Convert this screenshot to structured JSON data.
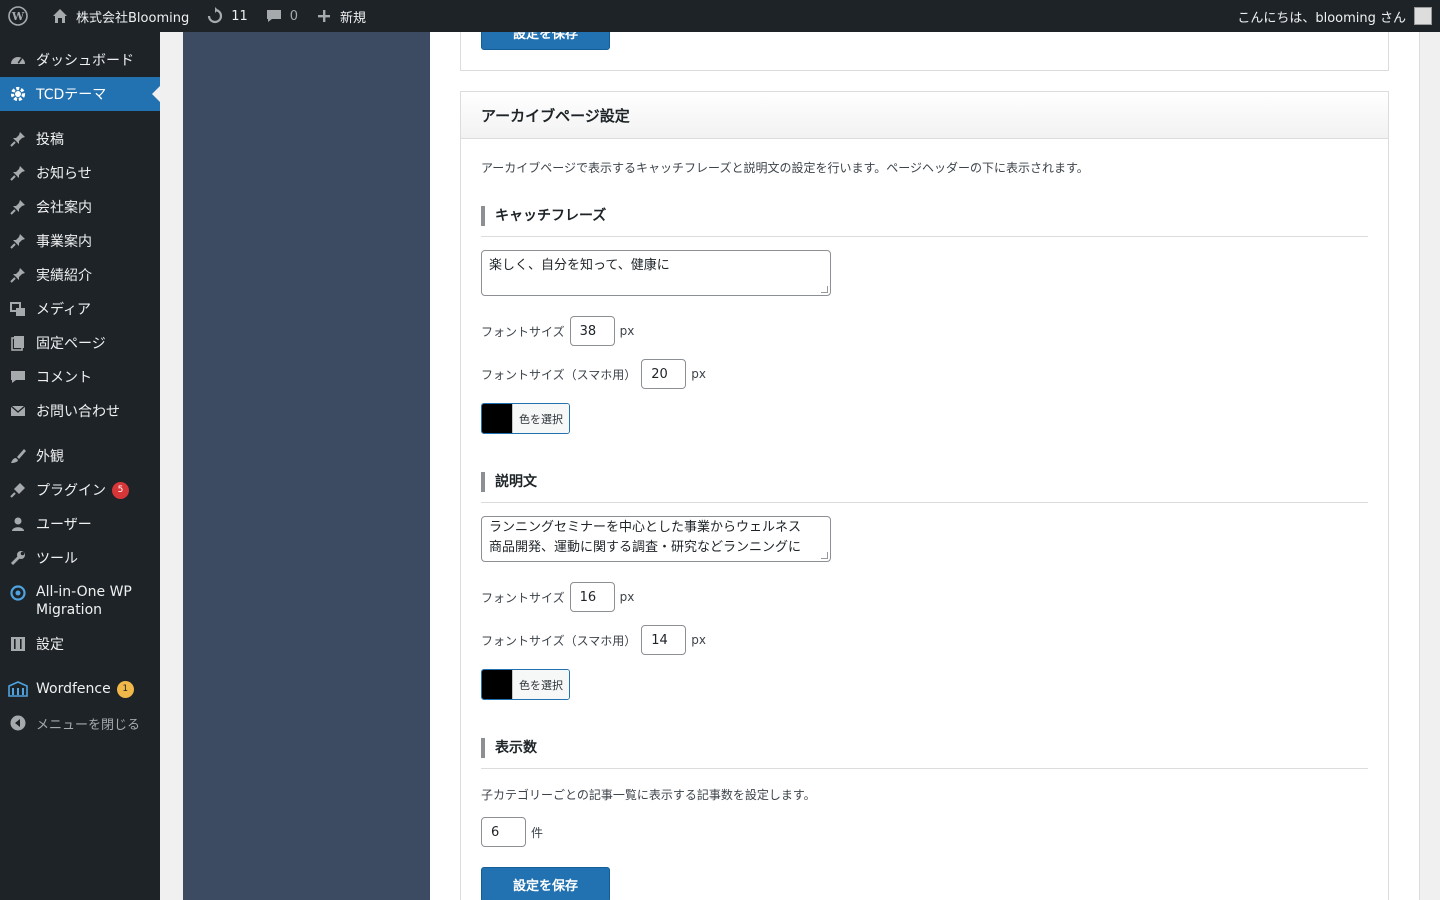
{
  "adminbar": {
    "site_name": "株式会社Blooming",
    "updates_count": "11",
    "comments_count": "0",
    "new_label": "新規",
    "greeting": "こんにちは、blooming さん"
  },
  "sidebar": {
    "items": [
      {
        "label": "ダッシュボード"
      },
      {
        "label": "TCDテーマ"
      },
      {
        "label": "投稿"
      },
      {
        "label": "お知らせ"
      },
      {
        "label": "会社案内"
      },
      {
        "label": "事業案内"
      },
      {
        "label": "実績紹介"
      },
      {
        "label": "メディア"
      },
      {
        "label": "固定ページ"
      },
      {
        "label": "コメント"
      },
      {
        "label": "お問い合わせ"
      },
      {
        "label": "外観"
      },
      {
        "label": "プラグイン",
        "badge": "5"
      },
      {
        "label": "ユーザー"
      },
      {
        "label": "ツール"
      },
      {
        "label": "All-in-One WP Migration"
      },
      {
        "label": "設定"
      },
      {
        "label": "Wordfence",
        "badge": "1"
      },
      {
        "label": "メニューを閉じる"
      }
    ]
  },
  "top_box": {
    "save_label": "設定を保存"
  },
  "archive": {
    "title": "アーカイブページ設定",
    "description": "アーカイブページで表示するキャッチフレーズと説明文の設定を行います。ページヘッダーの下に表示されます。",
    "catchphrase": {
      "heading": "キャッチフレーズ",
      "text": "楽しく、自分を知って、健康に",
      "font_size_label": "フォントサイズ",
      "font_size": "38",
      "font_size_sp_label": "フォントサイズ（スマホ用）",
      "font_size_sp": "20",
      "unit": "px",
      "color_label": "色を選択"
    },
    "explanation": {
      "heading": "説明文",
      "text_line1": "ランニングセミナーを中心とした事業からウェルネス",
      "text_line2": "商品開発、運動に関する調査・研究などランニングに",
      "font_size_label": "フォントサイズ",
      "font_size": "16",
      "font_size_sp_label": "フォントサイズ（スマホ用）",
      "font_size_sp": "14",
      "unit": "px",
      "color_label": "色を選択"
    },
    "count": {
      "heading": "表示数",
      "description": "子カテゴリーごとの記事一覧に表示する記事数を設定します。",
      "value": "6",
      "unit": "件"
    },
    "save_label": "設定を保存"
  },
  "colors": {
    "admin_dark": "#1d2327",
    "accent": "#2271b1",
    "theme_panel": "#3c4b62"
  }
}
